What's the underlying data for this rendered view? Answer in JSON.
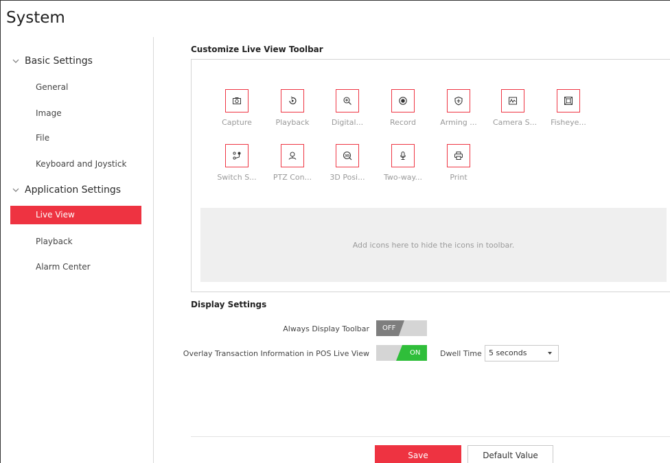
{
  "page": {
    "title": "System"
  },
  "sidebar": {
    "groups": [
      {
        "label": "Basic Settings",
        "items": [
          "General",
          "Image",
          "File",
          "Keyboard and Joystick"
        ]
      },
      {
        "label": "Application Settings",
        "items": [
          "Live View",
          "Playback",
          "Alarm Center"
        ]
      }
    ],
    "active_item": "Live View"
  },
  "toolbar_section": {
    "title": "Customize Live View Toolbar",
    "tools": [
      {
        "label": "Capture",
        "icon": "camera-icon"
      },
      {
        "label": "Playback",
        "icon": "playback-icon"
      },
      {
        "label": "Digital...",
        "icon": "zoom-in-icon"
      },
      {
        "label": "Record",
        "icon": "record-icon"
      },
      {
        "label": "Arming ...",
        "icon": "shield-icon"
      },
      {
        "label": "Camera S...",
        "icon": "camera-status-icon"
      },
      {
        "label": "Fisheye...",
        "icon": "fisheye-icon"
      },
      {
        "label": "Switch S...",
        "icon": "switch-stream-icon"
      },
      {
        "label": "PTZ Con...",
        "icon": "ptz-icon"
      },
      {
        "label": "3D Posi...",
        "icon": "3d-position-icon"
      },
      {
        "label": "Two-way...",
        "icon": "microphone-icon"
      },
      {
        "label": "Print",
        "icon": "print-icon"
      }
    ],
    "drop_hint": "Add icons here to hide the icons in toolbar."
  },
  "display_settings": {
    "title": "Display Settings",
    "always_display_toolbar": {
      "label": "Always Display Toolbar",
      "state": "OFF"
    },
    "overlay_transaction": {
      "label": "Overlay Transaction Information in POS Live View",
      "state": "ON"
    },
    "dwell_time": {
      "label": "Dwell Time",
      "value": "5 seconds"
    }
  },
  "footer": {
    "save_label": "Save",
    "default_label": "Default Value"
  },
  "colors": {
    "accent": "#ee3341",
    "toggle_on": "#2fbe3a",
    "toggle_off": "#7e7e7e"
  }
}
